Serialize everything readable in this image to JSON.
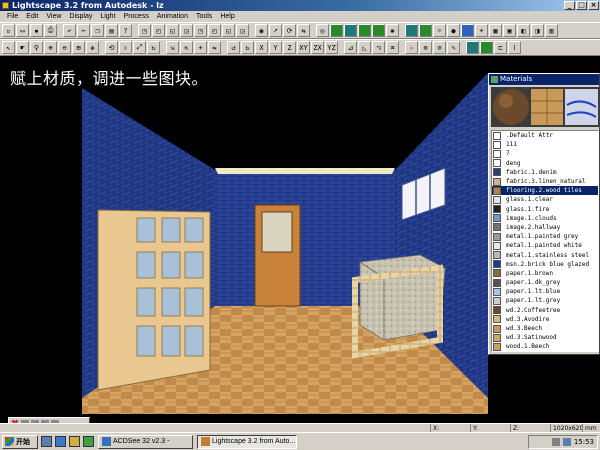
{
  "window": {
    "title": "Lightscape 3.2 from Autodesk - lz"
  },
  "menu": [
    "File",
    "Edit",
    "View",
    "Display",
    "Light",
    "Process",
    "Animation",
    "Tools",
    "Help"
  ],
  "toolbar_axes": [
    "X",
    "Y",
    "Z",
    "XY",
    "ZX",
    "YZ"
  ],
  "caption": "赋上材质，调进一些图块。",
  "materials": {
    "title": "Materials",
    "items": [
      {
        "name": ".Default Attr",
        "color": "#ffffff"
      },
      {
        "name": "111",
        "color": "#ffffff"
      },
      {
        "name": "7",
        "color": "#ffffff"
      },
      {
        "name": "deng",
        "color": "#ffffff"
      },
      {
        "name": "fabric.1.denim",
        "color": "#2b3e78"
      },
      {
        "name": "fabric.3.linen_natural",
        "color": "#c8b48a"
      },
      {
        "name": "flooring.2.wood tiles",
        "color": "#b48044",
        "selected": true
      },
      {
        "name": "glass.1.clear",
        "color": "#d8e8f0"
      },
      {
        "name": "glass.1.fire",
        "color": "#202020"
      },
      {
        "name": "image.1.clouds",
        "color": "#6f9ad0"
      },
      {
        "name": "image.2.hallway",
        "color": "#7a7468"
      },
      {
        "name": "metal.1.painted grey",
        "color": "#9a9a9a"
      },
      {
        "name": "metal.1.painted white",
        "color": "#e8e8e8"
      },
      {
        "name": "metal.1.stainless steel",
        "color": "#b8b8c0"
      },
      {
        "name": "msn.2.brick blue glazed",
        "color": "#1f3a8a"
      },
      {
        "name": "paper.1.brown",
        "color": "#8a6a40"
      },
      {
        "name": "paper.1.dk_grey",
        "color": "#555555"
      },
      {
        "name": "paper.1.lt.blue",
        "color": "#a8c4e8"
      },
      {
        "name": "paper.1.lt.grey",
        "color": "#cccccc"
      },
      {
        "name": "wd.2.Coffeetree",
        "color": "#6a4a2a"
      },
      {
        "name": "wd.3.Avodire",
        "color": "#d8b878"
      },
      {
        "name": "wd.3.Beech",
        "color": "#c89a5a"
      },
      {
        "name": "wd.3.Satinwood",
        "color": "#d0a860"
      },
      {
        "name": "wood.1.Beech",
        "color": "#c8a060"
      }
    ]
  },
  "ime": {
    "label": "英"
  },
  "statusbar": {
    "x": "X:",
    "y": "Y:",
    "z": "Z:",
    "resolution": "1020x620",
    "units": "mm"
  },
  "taskbar": {
    "start": "开始",
    "tasks": [
      {
        "label": "ACDSee 32 v2.3 -",
        "active": false
      },
      {
        "label": "Lightscape 3.2 from Auto...",
        "active": true
      }
    ],
    "clock": "15:53"
  }
}
